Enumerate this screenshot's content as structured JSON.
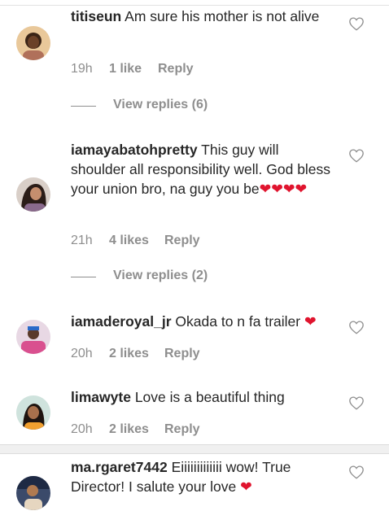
{
  "comments": [
    {
      "username": "titiseun",
      "body": "Am sure his mother is not alive",
      "time": "19h",
      "likes": "1 like",
      "reply": "Reply",
      "view_replies": "View replies (6)"
    },
    {
      "username": "iamayabatohpretty",
      "body": "This guy will shoulder all responsibility well. God bless your union bro, na guy you be",
      "hearts": "❤❤❤❤",
      "time": "21h",
      "likes": "4 likes",
      "reply": "Reply",
      "view_replies": "View replies (2)"
    },
    {
      "username": "iamaderoyal_jr",
      "body": "Okada to n fa trailer",
      "hearts": "❤",
      "time": "20h",
      "likes": "2 likes",
      "reply": "Reply"
    },
    {
      "username": "limawyte",
      "body": "Love is a beautiful thing",
      "time": "20h",
      "likes": "2 likes",
      "reply": "Reply"
    },
    {
      "username": "ma.rgaret7442",
      "body": "Eiiiiiiiiiiiii wow! True Director! I salute your love",
      "hearts": "❤"
    }
  ],
  "icons": {
    "like": "heart-outline-icon"
  },
  "colors": {
    "heart_emoji": "#e0142e",
    "meta_text": "#8e8e8e"
  }
}
